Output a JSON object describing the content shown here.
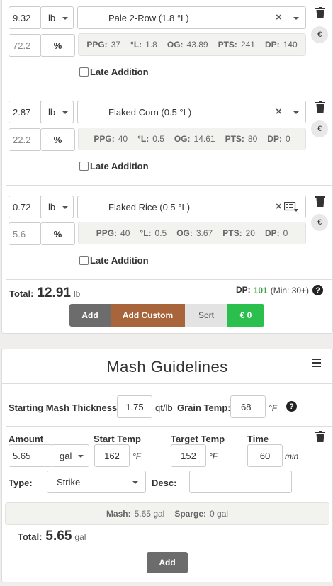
{
  "fermentables": [
    {
      "amount": "9.32",
      "unit": "lb",
      "percent": "72.2",
      "percent_sign": "%",
      "name": "Pale 2-Row (1.8 °L)",
      "stats": {
        "ppg_label": "PPG:",
        "ppg": "37",
        "l_label": "°L:",
        "l": "1.8",
        "og_label": "OG:",
        "og": "43.89",
        "pts_label": "PTS:",
        "pts": "241",
        "dp_label": "DP:",
        "dp": "140"
      },
      "late_addition": "Late Addition",
      "currency": "€"
    },
    {
      "amount": "2.87",
      "unit": "lb",
      "percent": "22.2",
      "percent_sign": "%",
      "name": "Flaked Corn (0.5 °L)",
      "stats": {
        "ppg_label": "PPG:",
        "ppg": "40",
        "l_label": "°L:",
        "l": "0.5",
        "og_label": "OG:",
        "og": "14.61",
        "pts_label": "PTS:",
        "pts": "80",
        "dp_label": "DP:",
        "dp": "0"
      },
      "late_addition": "Late Addition",
      "currency": "€"
    },
    {
      "amount": "0.72",
      "unit": "lb",
      "percent": "5.6",
      "percent_sign": "%",
      "name": "Flaked Rice (0.5 °L)",
      "stats": {
        "ppg_label": "PPG:",
        "ppg": "40",
        "l_label": "°L:",
        "l": "0.5",
        "og_label": "OG:",
        "og": "3.67",
        "pts_label": "PTS:",
        "pts": "20",
        "dp_label": "DP:",
        "dp": "0"
      },
      "late_addition": "Late Addition",
      "currency": "€"
    }
  ],
  "fermentables_total": {
    "label": "Total:",
    "value": "12.91",
    "unit": "lb",
    "dp_label": "DP:",
    "dp_value": "101",
    "dp_min": "(Min: 30+)"
  },
  "fermentable_buttons": {
    "add": "Add",
    "add_custom": "Add Custom",
    "sort": "Sort",
    "cost": "€ 0"
  },
  "mash": {
    "title": "Mash Guidelines",
    "thickness_label": "Starting Mash Thickness:",
    "thickness_value": "1.75",
    "thickness_unit": "qt/lb",
    "grain_temp_label": "Grain Temp:",
    "grain_temp_value": "68",
    "grain_temp_unit": "°F",
    "step": {
      "amount_label": "Amount",
      "amount_value": "5.65",
      "amount_unit": "gal",
      "start_temp_label": "Start Temp",
      "start_temp_value": "162",
      "start_temp_unit": "°F",
      "target_temp_label": "Target Temp",
      "target_temp_value": "152",
      "target_temp_unit": "°F",
      "time_label": "Time",
      "time_value": "60",
      "time_unit": "min",
      "type_label": "Type:",
      "type_value": "Strike",
      "desc_label": "Desc:",
      "desc_value": ""
    },
    "summary": {
      "mash_label": "Mash:",
      "mash_value": "5.65 gal",
      "sparge_label": "Sparge:",
      "sparge_value": "0 gal"
    },
    "total_label": "Total:",
    "total_value": "5.65",
    "total_unit": "gal",
    "add_button": "Add"
  },
  "colors": {
    "add": "#6c6c6c",
    "add_custom": "#a8643a",
    "sort": "#e3e3e3",
    "cost": "#2bbf4e",
    "dp_value": "#3aa040"
  }
}
